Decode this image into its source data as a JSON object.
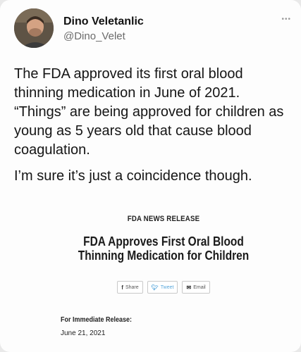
{
  "tweet": {
    "display_name": "Dino Veletanlic",
    "handle": "@Dino_Velet",
    "more_icon": "ellipsis-icon",
    "paragraphs": [
      "The FDA approved its first oral blood thinning medication in June of 2021. “Things” are being approved for children as young as 5 years old that cause blood coagulation.",
      "I’m sure it’s just a coincidence though."
    ]
  },
  "release": {
    "kicker": "FDA NEWS RELEASE",
    "title": "FDA Approves First Oral Blood Thinning Medication for Children",
    "share": {
      "share_label": "Share",
      "tweet_label": "Tweet",
      "email_label": "Email"
    },
    "immediate_label": "For Immediate Release:",
    "date": "June 21, 2021"
  },
  "colors": {
    "twitter_blue": "#5aa8dc",
    "handle_gray": "#6b6b6b"
  }
}
